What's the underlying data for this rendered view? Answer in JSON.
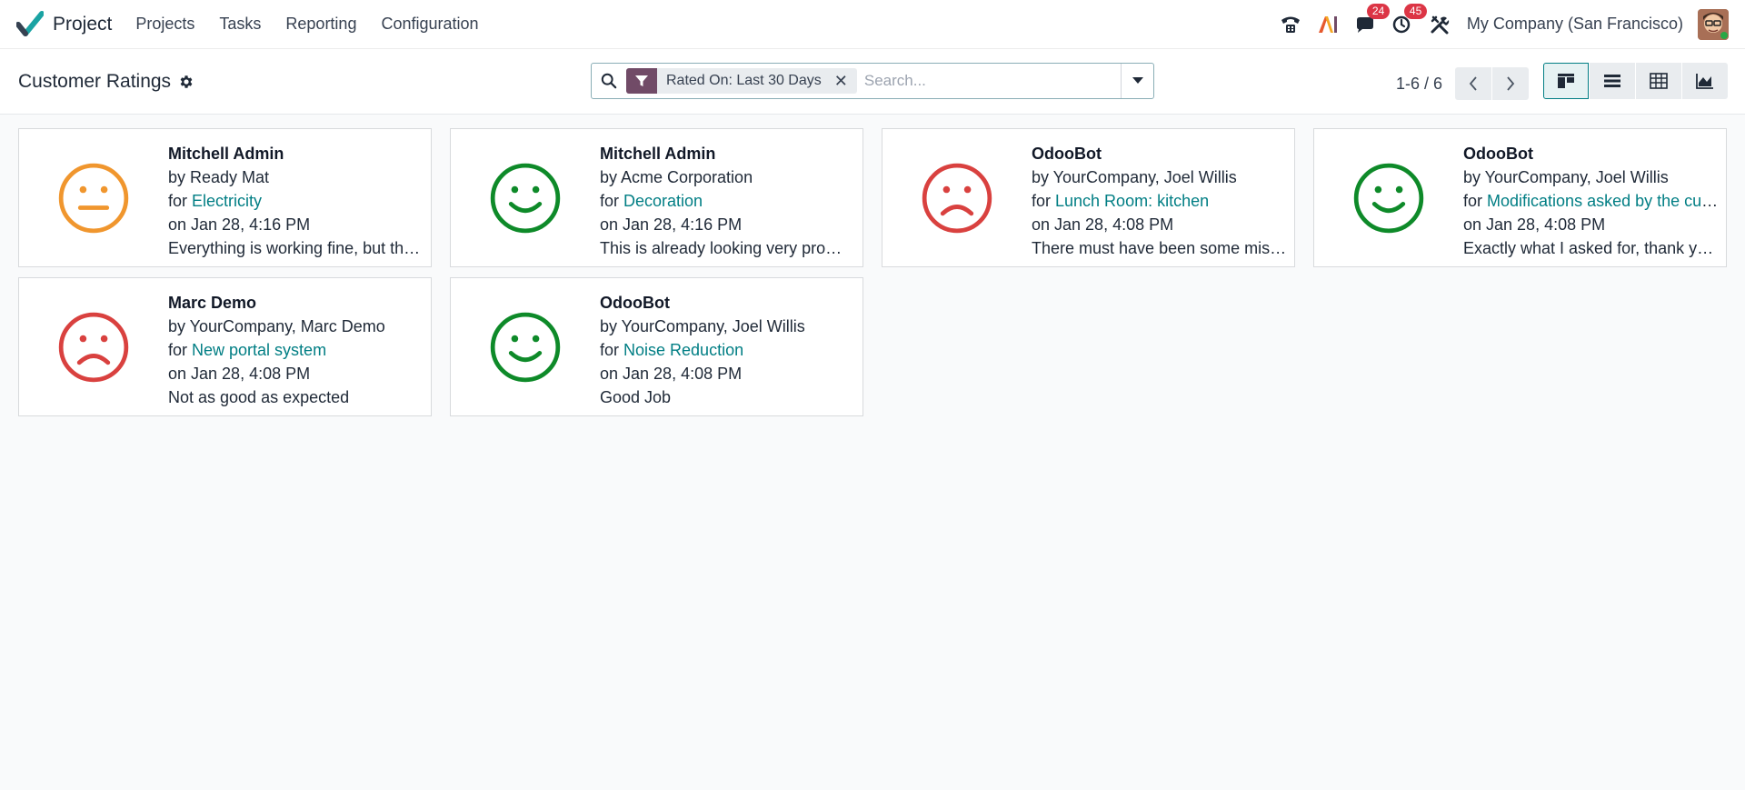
{
  "app": {
    "name": "Project"
  },
  "nav": {
    "items": [
      "Projects",
      "Tasks",
      "Reporting",
      "Configuration"
    ]
  },
  "systray": {
    "messages_count": "24",
    "activities_count": "45",
    "company": "My Company (San Francisco)"
  },
  "control": {
    "title": "Customer Ratings",
    "facet": "Rated On: Last 30 Days",
    "search_placeholder": "Search...",
    "pager": "1-6 / 6"
  },
  "colors": {
    "brand": "#714b67",
    "accent": "#017e84",
    "good": "#0e8a29",
    "neutral": "#f0962e",
    "bad": "#d9413f"
  },
  "ratings": [
    {
      "name": "Mitchell Admin",
      "by": "by Ready Mat",
      "for_prefix": "for ",
      "task": "Electricity",
      "date": "on Jan 28, 4:16 PM",
      "feedback": "Everything is working fine, but the...",
      "mood": "neutral"
    },
    {
      "name": "Mitchell Admin",
      "by": "by Acme Corporation",
      "for_prefix": "for ",
      "task": "Decoration",
      "date": "on Jan 28, 4:16 PM",
      "feedback": "This is already looking very promis...",
      "mood": "good"
    },
    {
      "name": "OdooBot",
      "by": "by YourCompany, Joel Willis",
      "for_prefix": "for ",
      "task": "Lunch Room: kitchen",
      "date": "on Jan 28, 4:08 PM",
      "feedback": "There must have been some misc...",
      "mood": "bad"
    },
    {
      "name": "OdooBot",
      "by": "by YourCompany, Joel Willis",
      "for_prefix": "for ",
      "task": "Modifications asked by the cus...",
      "date": "on Jan 28, 4:08 PM",
      "feedback": "Exactly what I asked for, thank you!",
      "mood": "good"
    },
    {
      "name": "Marc Demo",
      "by": "by YourCompany, Marc Demo",
      "for_prefix": "for ",
      "task": "New portal system",
      "date": "on Jan 28, 4:08 PM",
      "feedback": "Not as good as expected",
      "mood": "bad"
    },
    {
      "name": "OdooBot",
      "by": "by YourCompany, Joel Willis",
      "for_prefix": "for ",
      "task": "Noise Reduction",
      "date": "on Jan 28, 4:08 PM",
      "feedback": "Good Job",
      "mood": "good"
    }
  ]
}
